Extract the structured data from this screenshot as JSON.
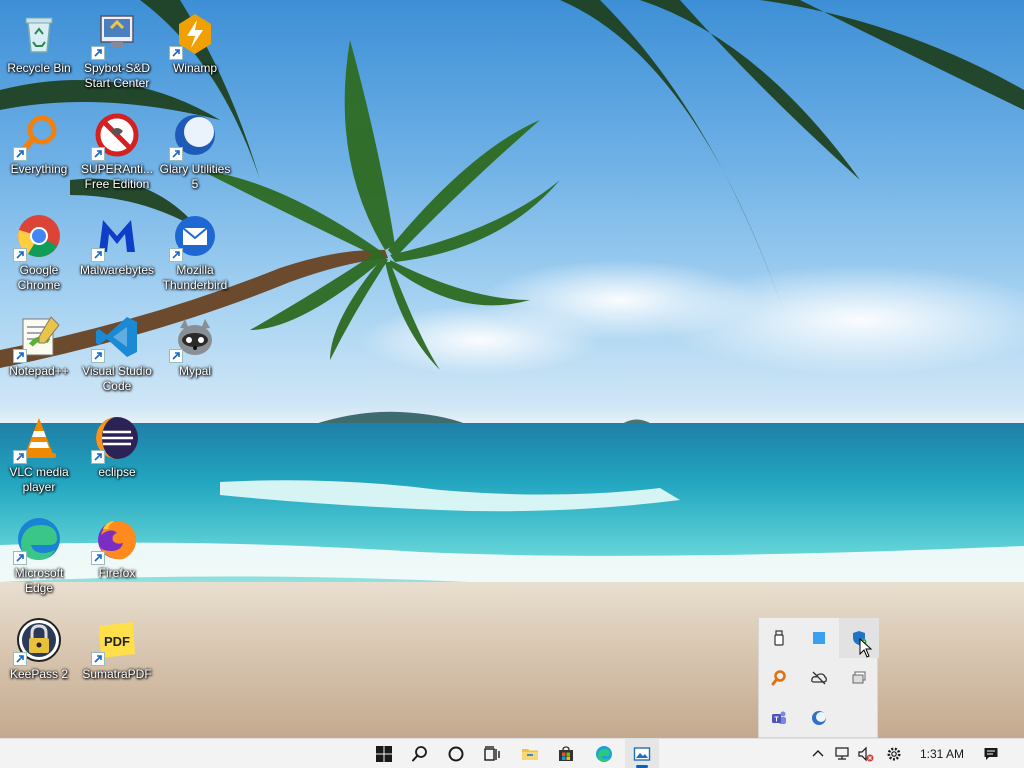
{
  "desktop": {
    "icons": [
      {
        "label": "Recycle Bin",
        "icon": "recycle-bin-icon"
      },
      {
        "label": "Spybot-S&D\nStart Center",
        "icon": "spybot-icon"
      },
      {
        "label": "Winamp",
        "icon": "winamp-icon"
      },
      {
        "label": "Everything",
        "icon": "everything-search-icon"
      },
      {
        "label": "SUPERAnti...\nFree Edition",
        "icon": "superantispyware-icon"
      },
      {
        "label": "Glary Utilities\n5",
        "icon": "glary-utilities-icon"
      },
      {
        "label": "Google\nChrome",
        "icon": "chrome-icon"
      },
      {
        "label": "Malwarebytes",
        "icon": "malwarebytes-icon"
      },
      {
        "label": "Mozilla\nThunderbird",
        "icon": "thunderbird-icon"
      },
      {
        "label": "Notepad++",
        "icon": "notepad-plus-plus-icon"
      },
      {
        "label": "Visual Studio\nCode",
        "icon": "vscode-icon"
      },
      {
        "label": "Mypal",
        "icon": "mypal-icon"
      },
      {
        "label": "VLC media\nplayer",
        "icon": "vlc-icon"
      },
      {
        "label": "eclipse",
        "icon": "eclipse-icon"
      },
      {
        "label": "Microsoft\nEdge",
        "icon": "edge-icon"
      },
      {
        "label": "Firefox",
        "icon": "firefox-icon"
      },
      {
        "label": "KeePass 2",
        "icon": "keepass-icon"
      },
      {
        "label": "SumatraPDF",
        "icon": "sumatrapdf-icon"
      }
    ]
  },
  "tray_flyout": {
    "icons": [
      "usb-drive-icon",
      "blue-square-icon",
      "windows-security-icon",
      "everything-tray-icon",
      "onedrive-offline-icon",
      "remote-desktop-icon",
      "teams-icon",
      "glary-tray-icon"
    ]
  },
  "taskbar": {
    "pinned": [
      "start-icon",
      "search-icon",
      "cortana-icon",
      "task-view-icon",
      "file-explorer-icon",
      "store-icon",
      "edge-icon",
      "photos-icon"
    ],
    "active_app": "photos-icon",
    "clock": "1:31 AM",
    "colors": {
      "accent": "#0067c0",
      "taskbar_bg": "#f3f3f3"
    }
  }
}
